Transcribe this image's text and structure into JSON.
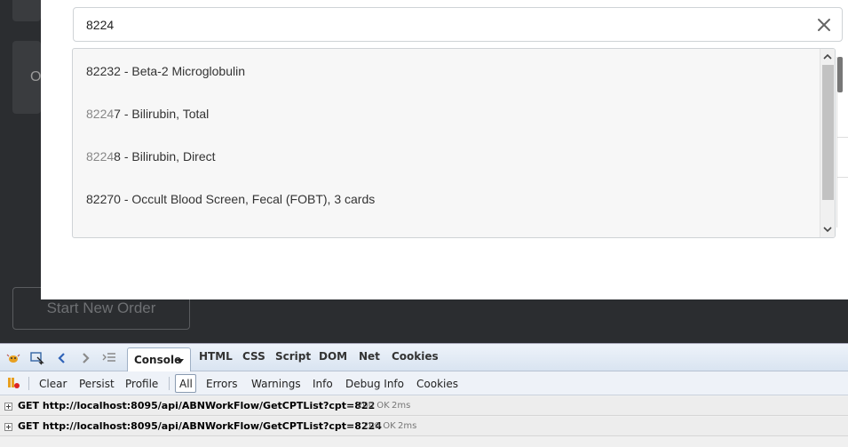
{
  "app": {
    "bg_card_letter": "O",
    "start_order_label": "Start New Order"
  },
  "search": {
    "value": "8224",
    "clear_icon": "close-icon"
  },
  "dropdown": {
    "items": [
      {
        "match": "",
        "rest": "82232 - Beta-2 Microglobulin"
      },
      {
        "match": "8224",
        "rest": "7 - Bilirubin, Total"
      },
      {
        "match": "8224",
        "rest": "8 - Bilirubin, Direct"
      },
      {
        "match": "",
        "rest": "82270 - Occult Blood Screen, Fecal (FOBT), 3 cards"
      }
    ]
  },
  "devtools": {
    "tabs": {
      "console": "Console",
      "html": "HTML",
      "css": "CSS",
      "script": "Script",
      "dom": "DOM",
      "net": "Net",
      "cookies": "Cookies"
    },
    "subtoolbar": {
      "clear": "Clear",
      "persist": "Persist",
      "profile": "Profile",
      "all": "All",
      "errors": "Errors",
      "warnings": "Warnings",
      "info": "Info",
      "debug_info": "Debug Info",
      "cookies": "Cookies"
    },
    "log": [
      {
        "text": "GET http://localhost:8095/api/ABNWorkFlow/GetCPTList?cpt=822",
        "status": "200 OK",
        "time": "2ms"
      },
      {
        "text": "GET http://localhost:8095/api/ABNWorkFlow/GetCPTList?cpt=8224",
        "status": "200 OK",
        "time": "2ms"
      }
    ]
  }
}
